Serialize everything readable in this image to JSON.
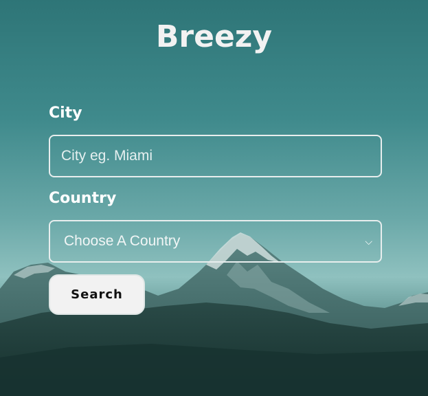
{
  "app": {
    "title": "Breezy"
  },
  "form": {
    "city_label": "City",
    "city_placeholder": "City eg. Miami",
    "city_value": "",
    "country_label": "Country",
    "country_selected": "Choose A Country",
    "search_label": "Search"
  },
  "icons": {
    "select_arrow": "chevron-down-icon"
  },
  "colors": {
    "text": "#ffffff",
    "button_bg": "#f2f2f2",
    "button_text": "#111111",
    "field_border": "#e8eeee"
  }
}
